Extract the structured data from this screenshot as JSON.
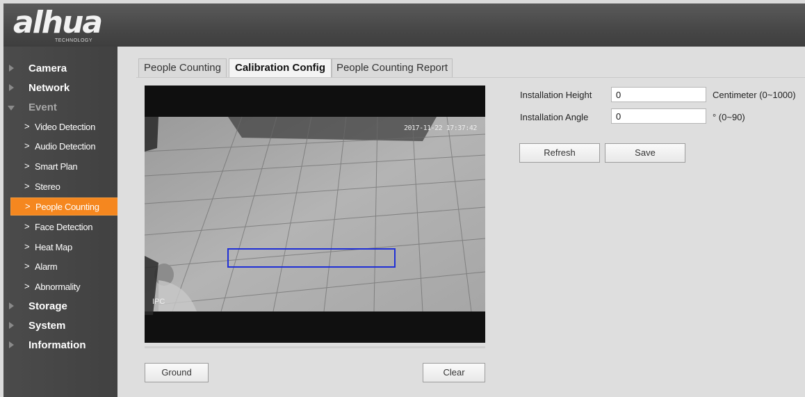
{
  "header": {
    "logo_text": "alhua",
    "logo_subtext": "TECHNOLOGY"
  },
  "sidebar": {
    "sections": [
      {
        "label": "Camera",
        "expanded": false
      },
      {
        "label": "Network",
        "expanded": false
      },
      {
        "label": "Event",
        "expanded": true
      },
      {
        "label": "Storage",
        "expanded": false
      },
      {
        "label": "System",
        "expanded": false
      },
      {
        "label": "Information",
        "expanded": false
      }
    ],
    "event_items": [
      {
        "label": "Video Detection",
        "active": false
      },
      {
        "label": "Audio Detection",
        "active": false
      },
      {
        "label": "Smart Plan",
        "active": false
      },
      {
        "label": "Stereo",
        "active": false
      },
      {
        "label": "People Counting",
        "active": true
      },
      {
        "label": "Face Detection",
        "active": false
      },
      {
        "label": "Heat Map",
        "active": false
      },
      {
        "label": "Alarm",
        "active": false
      },
      {
        "label": "Abnormality",
        "active": false
      }
    ],
    "active_color": "#f5871f"
  },
  "tabs": [
    {
      "label": "People Counting",
      "active": false
    },
    {
      "label": "Calibration Config",
      "active": true
    },
    {
      "label": "People Counting Report",
      "active": false
    }
  ],
  "video": {
    "timestamp": "2017-11-22 17:37:42",
    "camera_label": "IPC",
    "calibration_box_color": "#1f2fd6"
  },
  "buttons": {
    "ground": "Ground",
    "clear": "Clear",
    "refresh": "Refresh",
    "save": "Save"
  },
  "form": {
    "installation_height": {
      "label": "Installation Height",
      "value": "0",
      "unit": "Centimeter (0~1000)"
    },
    "installation_angle": {
      "label": "Installation Angle",
      "value": "0",
      "unit": "° (0~90)"
    }
  }
}
